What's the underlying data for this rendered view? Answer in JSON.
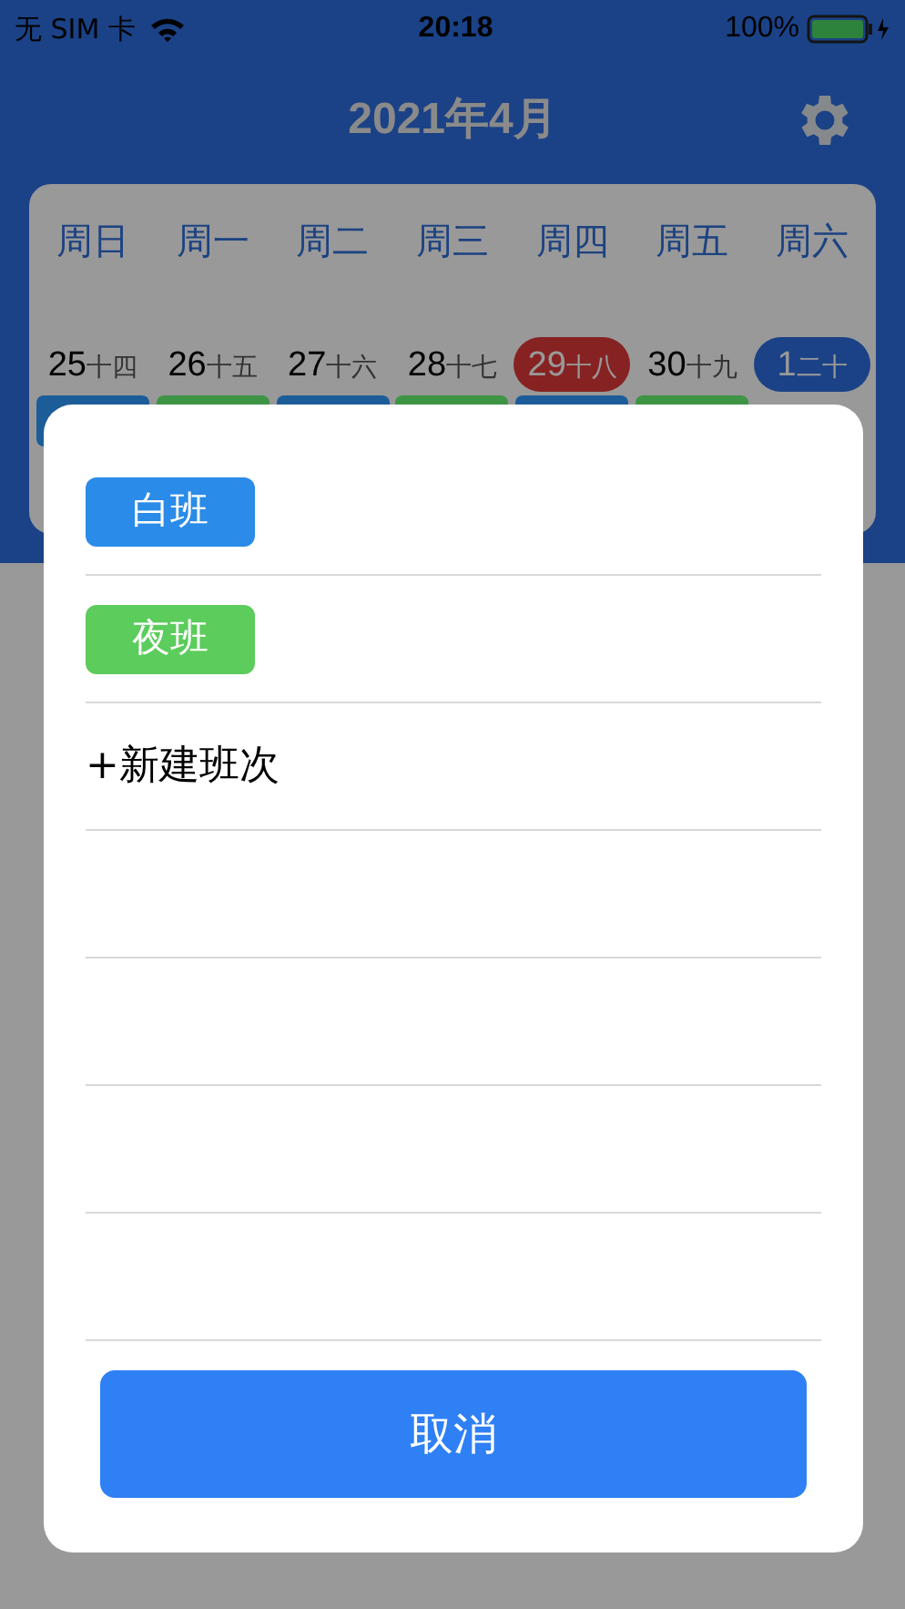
{
  "status_bar": {
    "carrier": "无 SIM 卡",
    "time": "20:18",
    "battery": "100%"
  },
  "header": {
    "title": "2021年4月"
  },
  "calendar": {
    "weekdays": [
      "周日",
      "周一",
      "周二",
      "周三",
      "周四",
      "周五",
      "周六"
    ],
    "days": [
      {
        "day": "25",
        "lunar": "十四",
        "today": false,
        "selected": false,
        "color": "#1c5d99"
      },
      {
        "day": "26",
        "lunar": "十五",
        "today": false,
        "selected": false,
        "color": "#3e9445"
      },
      {
        "day": "27",
        "lunar": "十六",
        "today": false,
        "selected": false,
        "color": "#1c5d99"
      },
      {
        "day": "28",
        "lunar": "十七",
        "today": false,
        "selected": false,
        "color": "#3e9445"
      },
      {
        "day": "29",
        "lunar": "十八",
        "today": true,
        "selected": false,
        "color": "#1c5d99"
      },
      {
        "day": "30",
        "lunar": "十九",
        "today": false,
        "selected": false,
        "color": "#3e9445"
      },
      {
        "day": "1",
        "lunar": "二十",
        "today": false,
        "selected": true
      }
    ]
  },
  "sheet": {
    "options": [
      {
        "kind": "shift",
        "label": "白班",
        "color": "#2a8be8"
      },
      {
        "kind": "shift",
        "label": "夜班",
        "color": "#5ccc5c"
      },
      {
        "kind": "action",
        "label": "+新建班次"
      }
    ],
    "cancel": "取消"
  }
}
